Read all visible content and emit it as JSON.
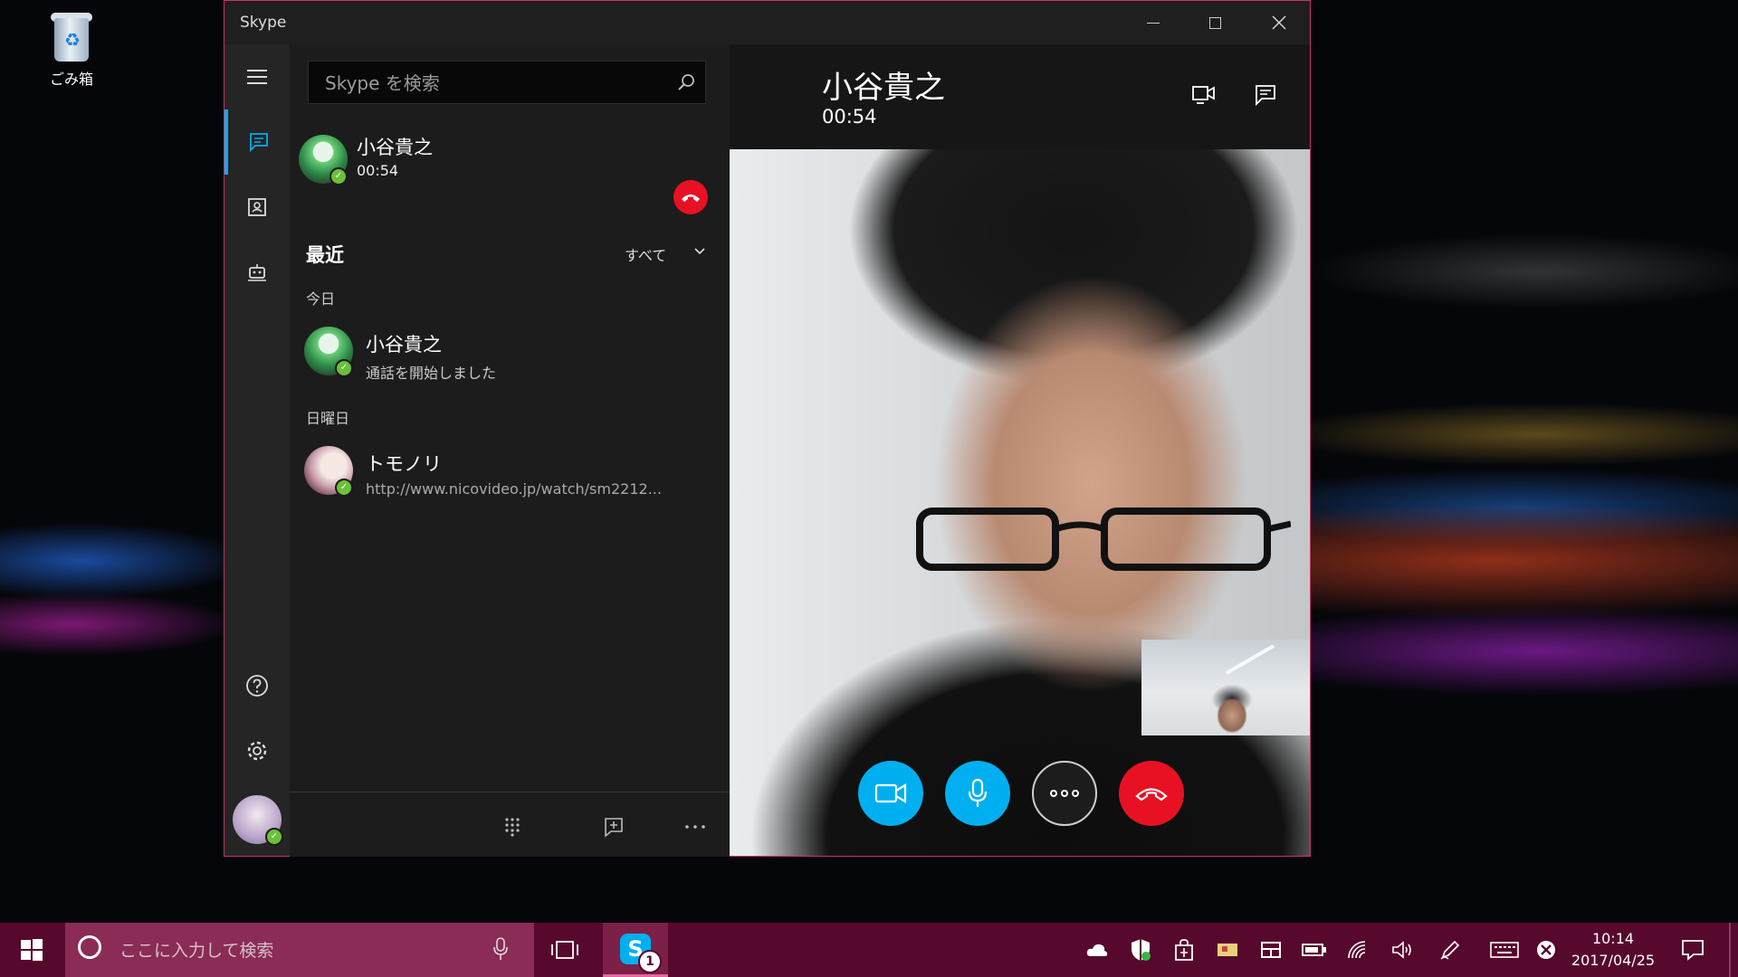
{
  "desktop": {
    "recycle_bin_label": "ごみ箱"
  },
  "window": {
    "title": "Skype"
  },
  "search": {
    "placeholder": "Skype を検索"
  },
  "active_call": {
    "name": "小谷貴之",
    "duration": "00:54"
  },
  "recent": {
    "heading": "最近",
    "filter": "すべて",
    "groups": [
      {
        "label": "今日",
        "items": [
          {
            "name": "小谷貴之",
            "preview": "通話を開始しました"
          }
        ]
      },
      {
        "label": "日曜日",
        "items": [
          {
            "name": "トモノリ",
            "preview": "http://www.nicovideo.jp/watch/sm2212..."
          }
        ]
      }
    ]
  },
  "call_view": {
    "name": "小谷貴之",
    "duration": "00:54"
  },
  "taskbar": {
    "search_placeholder": "ここに入力して検索",
    "skype_badge": "1",
    "time": "10:14",
    "date": "2017/04/25"
  },
  "colors": {
    "accent": "#00aff0",
    "end_call": "#e81123",
    "online": "#6bbf3a",
    "taskbar": "#57082d",
    "window_border": "#c8346a"
  }
}
